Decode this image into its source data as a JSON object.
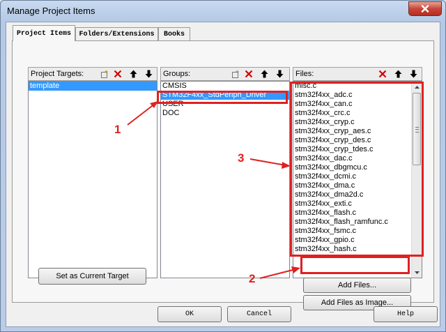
{
  "window": {
    "title": "Manage Project Items"
  },
  "tabs": [
    {
      "label": "Project Items",
      "active": true
    },
    {
      "label": "Folders/Extensions",
      "active": false
    },
    {
      "label": "Books",
      "active": false
    }
  ],
  "targets": {
    "label": "Project Targets:",
    "items": [
      "template"
    ],
    "selected_index": 0,
    "set_current_button": "Set as Current Target"
  },
  "groups": {
    "label": "Groups:",
    "items": [
      "CMSIS",
      "STM32F4xx_StdPeriph_Driver",
      "USER",
      "DOC"
    ],
    "selected_index": 1
  },
  "files": {
    "label": "Files:",
    "items": [
      "misc.c",
      "stm32f4xx_adc.c",
      "stm32f4xx_can.c",
      "stm32f4xx_crc.c",
      "stm32f4xx_cryp.c",
      "stm32f4xx_cryp_aes.c",
      "stm32f4xx_cryp_des.c",
      "stm32f4xx_cryp_tdes.c",
      "stm32f4xx_dac.c",
      "stm32f4xx_dbgmcu.c",
      "stm32f4xx_dcmi.c",
      "stm32f4xx_dma.c",
      "stm32f4xx_dma2d.c",
      "stm32f4xx_exti.c",
      "stm32f4xx_flash.c",
      "stm32f4xx_flash_ramfunc.c",
      "stm32f4xx_fsmc.c",
      "stm32f4xx_gpio.c",
      "stm32f4xx_hash.c"
    ],
    "add_files_button": "Add Files...",
    "add_files_image_button": "Add Files as Image..."
  },
  "footer": {
    "ok": "OK",
    "cancel": "Cancel",
    "help": "Help"
  },
  "annotations": [
    "1",
    "2",
    "3"
  ],
  "colors": {
    "annotation_red": "#e02020",
    "selection_blue": "#3399ff"
  },
  "icons": {
    "new": "new-item-icon",
    "delete": "delete-icon",
    "up": "arrow-up-icon",
    "down": "arrow-down-icon",
    "close": "close-icon"
  }
}
